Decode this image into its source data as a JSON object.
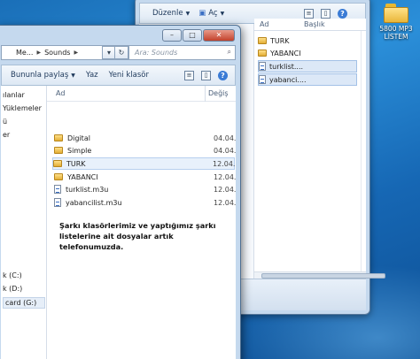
{
  "desktop": {
    "icon_label": "5800 MP3 LİSTEM"
  },
  "back_window": {
    "toolbar": {
      "organize": "Düzenle",
      "open": "Aç"
    },
    "columns": {
      "name": "Ad",
      "title": "Başlık"
    },
    "items": [
      {
        "name": "TURK",
        "type": "folder",
        "selected": false
      },
      {
        "name": "YABANCI",
        "type": "folder",
        "selected": false
      },
      {
        "name": "turklist....",
        "type": "playlist",
        "selected": true
      },
      {
        "name": "yabanci....",
        "type": "playlist",
        "selected": true
      }
    ]
  },
  "front_window": {
    "address": {
      "part1": "Me...",
      "part2": "Sounds"
    },
    "search_placeholder": "Ara: Sounds",
    "toolbar": {
      "share": "Bununla paylaş",
      "burn": "Yaz",
      "new_folder": "Yeni klasör"
    },
    "nav": [
      {
        "label": "ılanlar"
      },
      {
        "label": "Yüklemeler"
      },
      {
        "label": "ü"
      },
      {
        "label": "er"
      },
      {
        "label": "k (C:)"
      },
      {
        "label": "k (D:)"
      },
      {
        "label": "card (G:)"
      }
    ],
    "columns": {
      "name": "Ad",
      "date": "Değiş"
    },
    "files": [
      {
        "name": "Digital",
        "type": "folder",
        "date": "04.04."
      },
      {
        "name": "Simple",
        "type": "folder",
        "date": "04.04."
      },
      {
        "name": "TURK",
        "type": "folder",
        "date": "12.04."
      },
      {
        "name": "YABANCI",
        "type": "folder",
        "date": "12.04."
      },
      {
        "name": "turklist.m3u",
        "type": "playlist",
        "date": "12.04."
      },
      {
        "name": "yabancilist.m3u",
        "type": "playlist",
        "date": "12.04."
      }
    ],
    "caption_text": "Şarkı klasörlerimiz ve yaptığımız şarkı listelerine ait dosyalar artık telefonumuzda."
  },
  "colors": {
    "desktop_blue": "#1a6fb8",
    "window_frame": "#c5d9ee",
    "selection": "#dce8f7"
  }
}
